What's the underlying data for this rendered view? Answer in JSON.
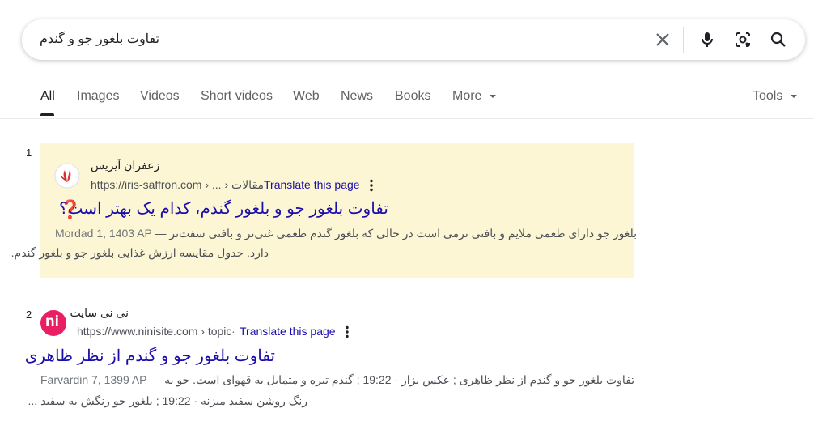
{
  "search": {
    "query": "تفاوت بلغور جو و گندم",
    "icons": [
      "close-icon",
      "microphone-icon",
      "lens-icon",
      "search-icon"
    ]
  },
  "tabs": [
    {
      "label": "All",
      "active": true
    },
    {
      "label": "Images"
    },
    {
      "label": "Videos"
    },
    {
      "label": "Short videos"
    },
    {
      "label": "Web"
    },
    {
      "label": "News"
    },
    {
      "label": "Books"
    },
    {
      "label": "More"
    }
  ],
  "tools_label": "Tools",
  "results": [
    {
      "number": "1",
      "site_name": "زعفران آیریس",
      "url": "https://iris-saffron.com › ... › مقالات",
      "translate": "Translate this page",
      "title": "تفاوت بلغور جو و بلغور گندم، کدام یک بهتر است؟",
      "emoji": "❓",
      "date": "Mordad 1, 1403 AP",
      "snippet_line1": "بلغور جو دارای طعمی ملایم و بافتی نرمی است در حالی که بلغور گندم طعمی غنی‌تر و بافتی سفت‌تر",
      "snippet_line2": "دارد. جدول مقایسه ارزش غذایی بلغور جو و بلغور گندم."
    },
    {
      "number": "2",
      "site_name": "نی نی سایت",
      "favicon_text": "ni",
      "url": "https://www.ninisite.com › topic",
      "translate": "Translate this page",
      "title": "تفاوت بلغور جو و گندم از نظر ظاهری",
      "date": "Farvardin 7, 1399 AP",
      "snippet_line1": "تفاوت بلغور جو و گندم از نظر ظاهری ; عکس بزار · 19:22 ; گندم تیره و متمایل به قهوای است. جو به",
      "snippet_line2": "رنگ روشن سفید میزنه · 19:22 ; بلغور جو رنگش به سفید ..."
    }
  ],
  "colors": {
    "link": "#1a0dab",
    "highlight": "#fdf6d4",
    "ninisite": "#e91e63"
  }
}
